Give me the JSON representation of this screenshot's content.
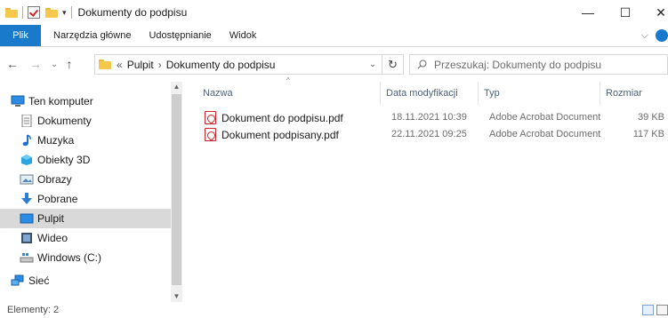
{
  "window": {
    "title": "Dokumenty do podpisu",
    "minimize_glyph": "—",
    "maximize_glyph": "☐",
    "close_glyph": "✕"
  },
  "ribbon": {
    "file_tab": "Plik",
    "tabs": [
      "Narzędzia główne",
      "Udostępnianie",
      "Widok"
    ],
    "expand_glyph": "⌵"
  },
  "nav": {
    "back_glyph": "←",
    "forward_glyph": "→",
    "recent_glyph": "⌄",
    "up_glyph": "↑",
    "overflow_glyph": "«",
    "breadcrumb": [
      "Pulpit",
      "Dokumenty do podpisu"
    ],
    "breadcrumb_sep": "›",
    "dropdown_glyph": "⌄",
    "refresh_glyph": "↻",
    "search_placeholder": "Przeszukaj: Dokumenty do podpisu"
  },
  "sidebar": {
    "items": [
      {
        "label": "Ten komputer",
        "icon": "computer-icon"
      },
      {
        "label": "Dokumenty",
        "icon": "documents-icon"
      },
      {
        "label": "Muzyka",
        "icon": "music-icon"
      },
      {
        "label": "Obiekty 3D",
        "icon": "objects-3d-icon"
      },
      {
        "label": "Obrazy",
        "icon": "pictures-icon"
      },
      {
        "label": "Pobrane",
        "icon": "downloads-icon"
      },
      {
        "label": "Pulpit",
        "icon": "desktop-icon",
        "selected": true
      },
      {
        "label": "Wideo",
        "icon": "video-icon"
      },
      {
        "label": "Windows (C:)",
        "icon": "drive-icon"
      },
      {
        "label": "Sieć",
        "icon": "network-icon"
      }
    ],
    "scroll_up_glyph": "▲",
    "scroll_down_glyph": "▼"
  },
  "files": {
    "columns": [
      "Nazwa",
      "Data modyfikacji",
      "Typ",
      "Rozmiar"
    ],
    "sort_glyph": "^",
    "rows": [
      {
        "name": "Dokument do podpisu.pdf",
        "date": "18.11.2021 10:39",
        "type": "Adobe Acrobat Document",
        "size": "39 KB",
        "icon": "pdf-icon"
      },
      {
        "name": "Dokument podpisany.pdf",
        "date": "22.11.2021 09:25",
        "type": "Adobe Acrobat Document",
        "size": "117 KB",
        "icon": "pdf-icon"
      }
    ]
  },
  "status": {
    "item_count": "Elementy: 2"
  },
  "colors": {
    "accent": "#1979ca",
    "folder": "#f6c94c",
    "pdf": "#d0262a",
    "selected_bg": "#d9d9d9"
  }
}
